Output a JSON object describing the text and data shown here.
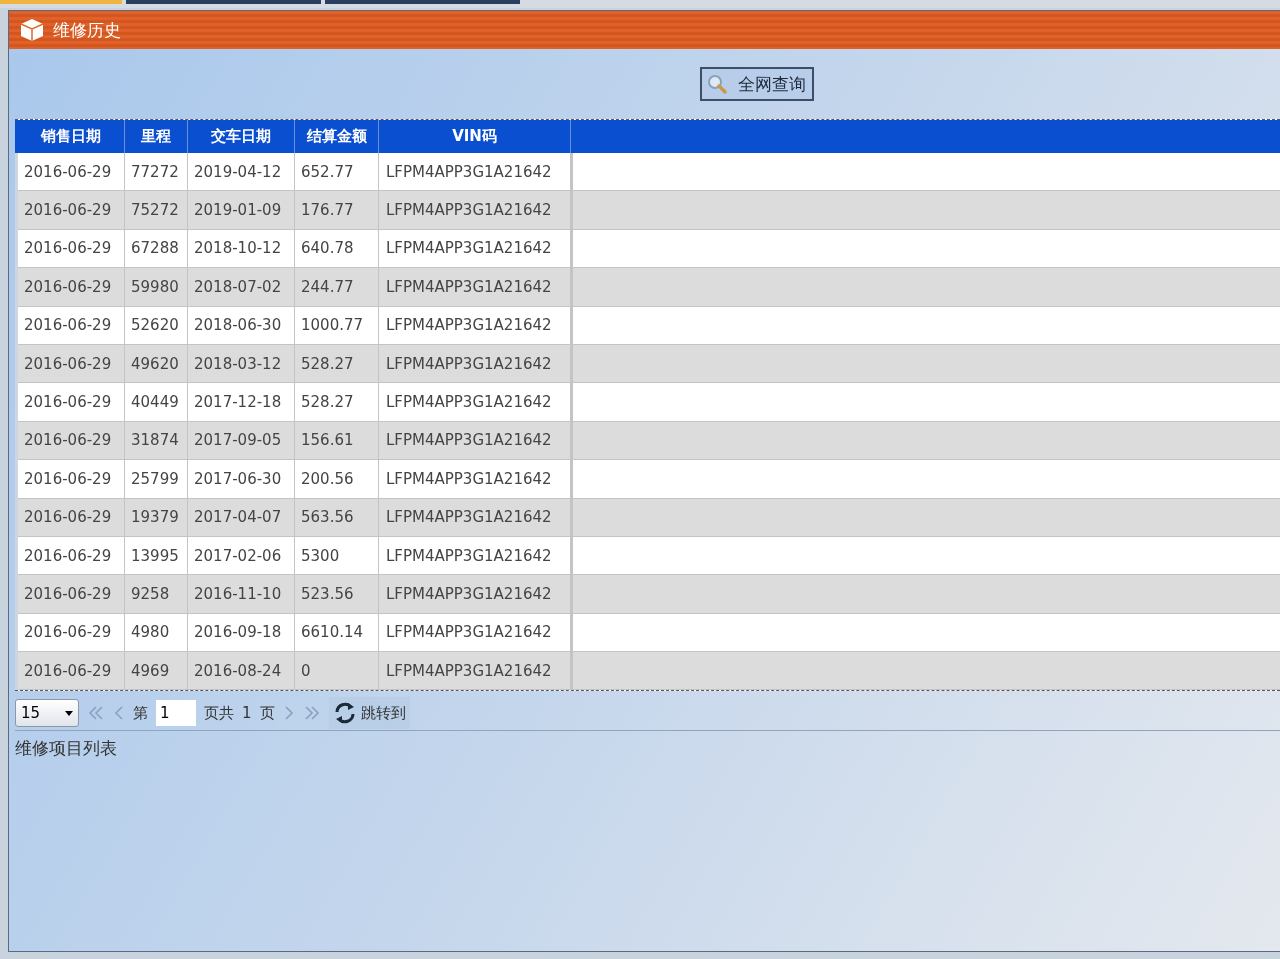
{
  "background_tabs": [
    {
      "selected": true
    },
    {
      "selected": false
    },
    {
      "selected": false
    }
  ],
  "window": {
    "title": "维修历史"
  },
  "toolbar": {
    "search_button": "全网查询"
  },
  "table": {
    "columns": [
      "销售日期",
      "里程",
      "交车日期",
      "结算金额",
      "VIN码"
    ],
    "rows": [
      [
        "2016-06-29",
        "77272",
        "2019-04-12",
        "652.77",
        "LFPM4APP3G1A21642"
      ],
      [
        "2016-06-29",
        "75272",
        "2019-01-09",
        "176.77",
        "LFPM4APP3G1A21642"
      ],
      [
        "2016-06-29",
        "67288",
        "2018-10-12",
        "640.78",
        "LFPM4APP3G1A21642"
      ],
      [
        "2016-06-29",
        "59980",
        "2018-07-02",
        "244.77",
        "LFPM4APP3G1A21642"
      ],
      [
        "2016-06-29",
        "52620",
        "2018-06-30",
        "1000.77",
        "LFPM4APP3G1A21642"
      ],
      [
        "2016-06-29",
        "49620",
        "2018-03-12",
        "528.27",
        "LFPM4APP3G1A21642"
      ],
      [
        "2016-06-29",
        "40449",
        "2017-12-18",
        "528.27",
        "LFPM4APP3G1A21642"
      ],
      [
        "2016-06-29",
        "31874",
        "2017-09-05",
        "156.61",
        "LFPM4APP3G1A21642"
      ],
      [
        "2016-06-29",
        "25799",
        "2017-06-30",
        "200.56",
        "LFPM4APP3G1A21642"
      ],
      [
        "2016-06-29",
        "19379",
        "2017-04-07",
        "563.56",
        "LFPM4APP3G1A21642"
      ],
      [
        "2016-06-29",
        "13995",
        "2017-02-06",
        "5300",
        "LFPM4APP3G1A21642"
      ],
      [
        "2016-06-29",
        "9258",
        "2016-11-10",
        "523.56",
        "LFPM4APP3G1A21642"
      ],
      [
        "2016-06-29",
        "4980",
        "2016-09-18",
        "6610.14",
        "LFPM4APP3G1A21642"
      ],
      [
        "2016-06-29",
        "4969",
        "2016-08-24",
        "0",
        "LFPM4APP3G1A21642"
      ]
    ]
  },
  "pager": {
    "page_size": "15",
    "page_prefix": "第",
    "page_value": "1",
    "page_middle": "页共",
    "total_pages": "1",
    "page_suffix": "页",
    "jump_button": "跳转到"
  },
  "caption": "维修项目列表"
}
